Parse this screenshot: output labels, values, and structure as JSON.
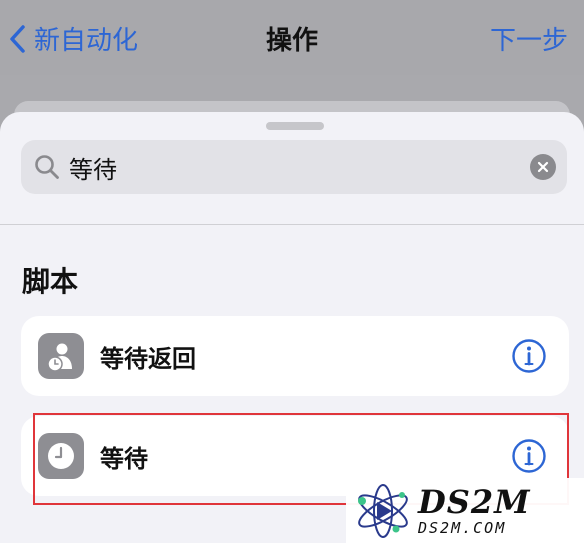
{
  "navbar": {
    "back_label": "新自动化",
    "title": "操作",
    "next_label": "下一步"
  },
  "search": {
    "value": "等待"
  },
  "section": {
    "title": "脚本"
  },
  "actions": [
    {
      "label": "等待返回",
      "icon": "person-clock-icon"
    },
    {
      "label": "等待",
      "icon": "clock-icon"
    }
  ],
  "watermark": {
    "main": "DS2M",
    "sub": "DS2M.COM"
  },
  "colors": {
    "accent": "#2d66d4",
    "highlight": "#e0353a",
    "icon_bg": "#8e8e93"
  }
}
